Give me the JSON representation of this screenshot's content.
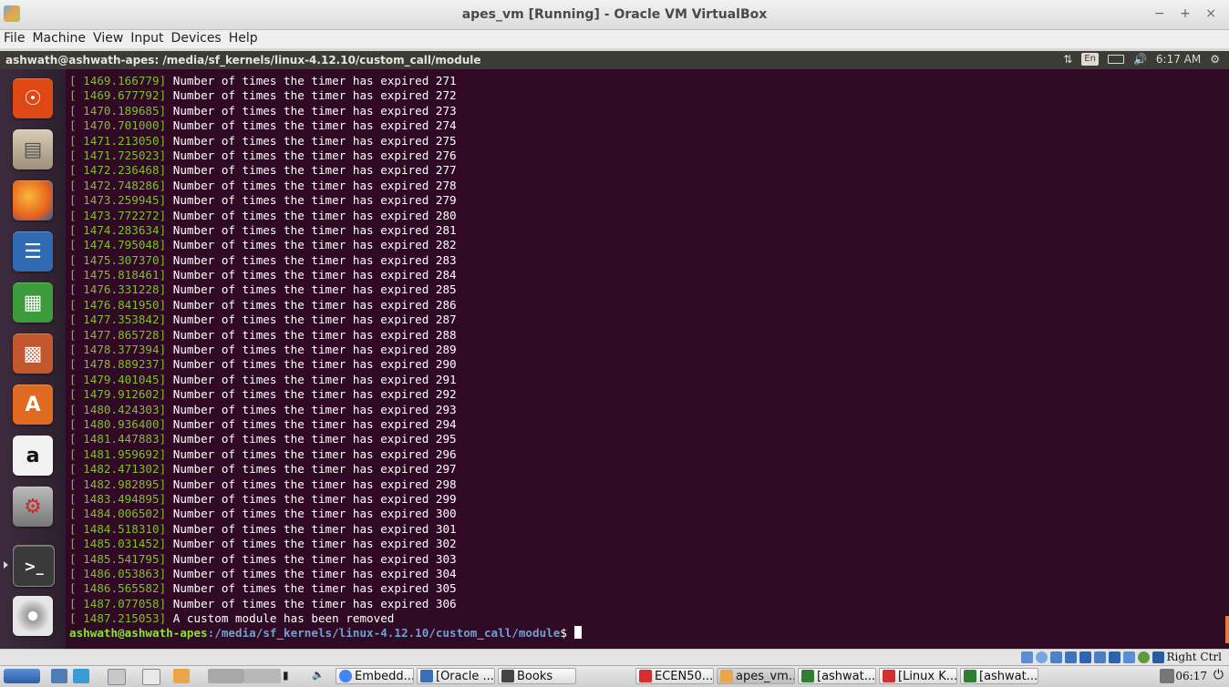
{
  "window": {
    "title": "apes_vm [Running] - Oracle VM VirtualBox",
    "controls": "− + ×"
  },
  "menu": [
    "File",
    "Machine",
    "View",
    "Input",
    "Devices",
    "Help"
  ],
  "guest_panel": {
    "title": "ashwath@ashwath-apes: /media/sf_kernels/linux-4.12.10/custom_call/module",
    "keyboard_indicator": "En",
    "time": "6:17 AM"
  },
  "launcher": [
    {
      "icon": "ubuntu-dash-icon",
      "color": "#dd4814"
    },
    {
      "icon": "files-icon",
      "color": "#b9a88f"
    },
    {
      "icon": "firefox-icon",
      "color": "#e8621d"
    },
    {
      "icon": "writer-icon",
      "color": "#2f6bb5"
    },
    {
      "icon": "calc-icon",
      "color": "#3c9b3a"
    },
    {
      "icon": "impress-icon",
      "color": "#c2562c"
    },
    {
      "icon": "software-center-icon",
      "color": "#e06a1f"
    },
    {
      "icon": "amazon-icon",
      "color": "#f2f2f2"
    },
    {
      "icon": "system-settings-icon",
      "color": "#9a9a9a"
    },
    {
      "icon": "terminal-icon",
      "color": "#3a3a3a"
    },
    {
      "icon": "dvd-icon",
      "color": "#cfcfcf"
    }
  ],
  "terminal": {
    "lines": [
      {
        "ts": "[ 1469.166779]",
        "msg": " Number of times the timer has expired 271"
      },
      {
        "ts": "[ 1469.677792]",
        "msg": " Number of times the timer has expired 272"
      },
      {
        "ts": "[ 1470.189685]",
        "msg": " Number of times the timer has expired 273"
      },
      {
        "ts": "[ 1470.701000]",
        "msg": " Number of times the timer has expired 274"
      },
      {
        "ts": "[ 1471.213050]",
        "msg": " Number of times the timer has expired 275"
      },
      {
        "ts": "[ 1471.725023]",
        "msg": " Number of times the timer has expired 276"
      },
      {
        "ts": "[ 1472.236468]",
        "msg": " Number of times the timer has expired 277"
      },
      {
        "ts": "[ 1472.748286]",
        "msg": " Number of times the timer has expired 278"
      },
      {
        "ts": "[ 1473.259945]",
        "msg": " Number of times the timer has expired 279"
      },
      {
        "ts": "[ 1473.772272]",
        "msg": " Number of times the timer has expired 280"
      },
      {
        "ts": "[ 1474.283634]",
        "msg": " Number of times the timer has expired 281"
      },
      {
        "ts": "[ 1474.795048]",
        "msg": " Number of times the timer has expired 282"
      },
      {
        "ts": "[ 1475.307370]",
        "msg": " Number of times the timer has expired 283"
      },
      {
        "ts": "[ 1475.818461]",
        "msg": " Number of times the timer has expired 284"
      },
      {
        "ts": "[ 1476.331228]",
        "msg": " Number of times the timer has expired 285"
      },
      {
        "ts": "[ 1476.841950]",
        "msg": " Number of times the timer has expired 286"
      },
      {
        "ts": "[ 1477.353842]",
        "msg": " Number of times the timer has expired 287"
      },
      {
        "ts": "[ 1477.865728]",
        "msg": " Number of times the timer has expired 288"
      },
      {
        "ts": "[ 1478.377394]",
        "msg": " Number of times the timer has expired 289"
      },
      {
        "ts": "[ 1478.889237]",
        "msg": " Number of times the timer has expired 290"
      },
      {
        "ts": "[ 1479.401045]",
        "msg": " Number of times the timer has expired 291"
      },
      {
        "ts": "[ 1479.912602]",
        "msg": " Number of times the timer has expired 292"
      },
      {
        "ts": "[ 1480.424303]",
        "msg": " Number of times the timer has expired 293"
      },
      {
        "ts": "[ 1480.936400]",
        "msg": " Number of times the timer has expired 294"
      },
      {
        "ts": "[ 1481.447883]",
        "msg": " Number of times the timer has expired 295"
      },
      {
        "ts": "[ 1481.959692]",
        "msg": " Number of times the timer has expired 296"
      },
      {
        "ts": "[ 1482.471302]",
        "msg": " Number of times the timer has expired 297"
      },
      {
        "ts": "[ 1482.982895]",
        "msg": " Number of times the timer has expired 298"
      },
      {
        "ts": "[ 1483.494895]",
        "msg": " Number of times the timer has expired 299"
      },
      {
        "ts": "[ 1484.006502]",
        "msg": " Number of times the timer has expired 300"
      },
      {
        "ts": "[ 1484.518310]",
        "msg": " Number of times the timer has expired 301"
      },
      {
        "ts": "[ 1485.031452]",
        "msg": " Number of times the timer has expired 302"
      },
      {
        "ts": "[ 1485.541795]",
        "msg": " Number of times the timer has expired 303"
      },
      {
        "ts": "[ 1486.053863]",
        "msg": " Number of times the timer has expired 304"
      },
      {
        "ts": "[ 1486.565582]",
        "msg": " Number of times the timer has expired 305"
      },
      {
        "ts": "[ 1487.077058]",
        "msg": " Number of times the timer has expired 306"
      },
      {
        "ts": "[ 1487.215053]",
        "msg": " A custom module has been removed"
      }
    ],
    "prompt_user": "ashwath@ashwath-apes",
    "prompt_path": ":/media/sf_kernels/linux-4.12.10/custom_call/module",
    "prompt_symbol": "$ "
  },
  "vbox_status": {
    "host_key": "Right Ctrl"
  },
  "taskbar": {
    "tasks": [
      {
        "label": "Embedd...",
        "icon": "chrome-icon",
        "color": "#4285f4"
      },
      {
        "label": "[Oracle ...",
        "icon": "virtualbox-icon",
        "color": "#3b6fb6"
      },
      {
        "label": "Books",
        "icon": "folder-icon",
        "color": "#444444"
      },
      {
        "label": "ECEN50...",
        "icon": "pdf-icon",
        "color": "#d32f2f"
      },
      {
        "label": "apes_vm...",
        "icon": "vm-icon",
        "color": "#e9a64b"
      },
      {
        "label": "[ashwat...",
        "icon": "terminal-icon",
        "color": "#2e7d32"
      },
      {
        "label": "[Linux K...",
        "icon": "pdf-icon",
        "color": "#d32f2f"
      },
      {
        "label": "[ashwat...",
        "icon": "terminal-icon",
        "color": "#2e7d32"
      }
    ],
    "clock": "06:17"
  }
}
